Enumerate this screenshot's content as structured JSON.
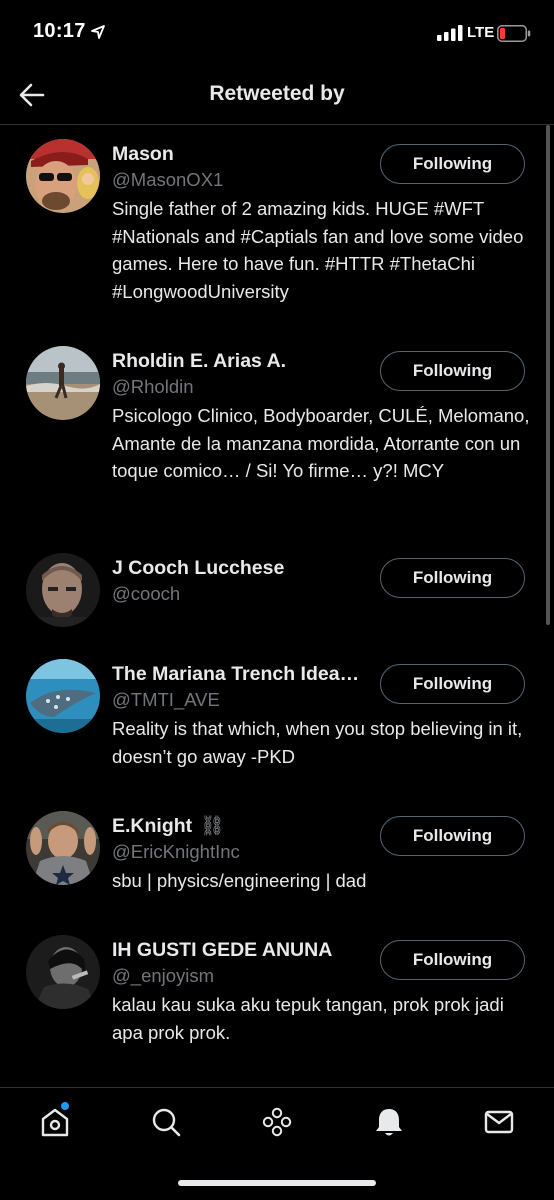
{
  "status_bar": {
    "time": "10:17",
    "network": "LTE"
  },
  "header": {
    "title": "Retweeted by"
  },
  "users": [
    {
      "name": "Mason",
      "handle": "@MasonOX1",
      "button": "Following",
      "bio": "Single father of 2 amazing kids. HUGE #WFT #Nationals and #Captials fan and love some video games. Here to have fun. #HTTR #ThetaChi #LongwoodUniversity"
    },
    {
      "name": "Rholdin E. Arias A.",
      "handle": "@Rholdin",
      "button": "Following",
      "bio": "Psicologo Clinico, Bodyboarder, CULÉ, Melomano, Amante de la manzana mordida, Atorrante con un toque comico… / Si! Yo firme… y?! MCY"
    },
    {
      "name": "J Cooch Lucchese",
      "handle": "@cooch",
      "button": "Following",
      "bio": ""
    },
    {
      "name": "The Mariana Trench Idea…",
      "handle": "@TMTI_AVE",
      "button": "Following",
      "bio": "Reality is that which, when you stop believing in it, doesn’t go away -PKD"
    },
    {
      "name": "E.Knight",
      "name_suffix": "⛓",
      "handle": "@EricKnightInc",
      "button": "Following",
      "bio": "sbu | physics/engineering | dad"
    },
    {
      "name": "IH GUSTI GEDE ANUNA",
      "handle": "@_enjoyism",
      "button": "Following",
      "bio": "kalau kau suka aku tepuk tangan, prok prok jadi apa prok prok."
    }
  ],
  "tabbar": {
    "items": [
      "home-icon",
      "search-icon",
      "spaces-icon",
      "notifications-icon",
      "messages-icon"
    ],
    "home_has_dot": true
  },
  "colors": {
    "accent": "#1d9bf0",
    "background": "#000000",
    "secondary_text": "#71767b"
  }
}
